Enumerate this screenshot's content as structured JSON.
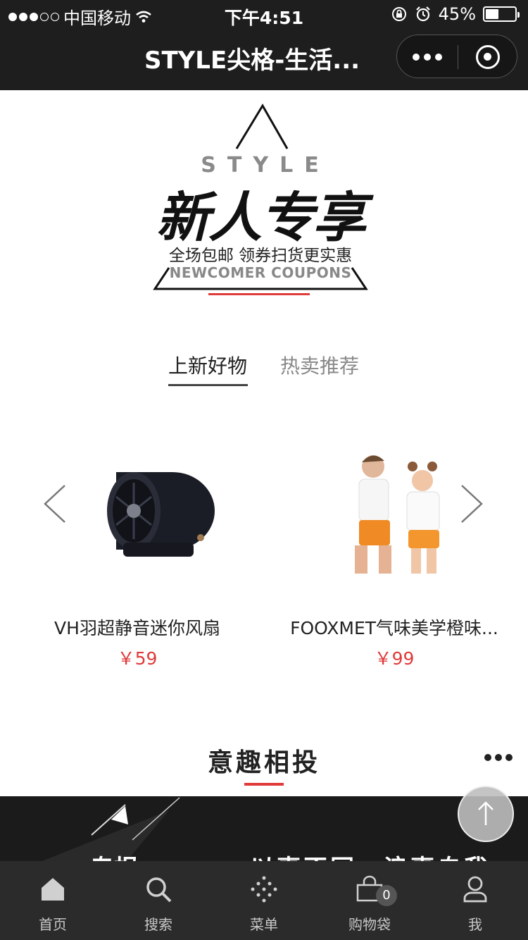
{
  "status_bar": {
    "carrier": "中国移动",
    "time": "下午4:51",
    "battery": "45%",
    "battery_level": 0.45
  },
  "nav": {
    "title": "STYLE尖格-生活..."
  },
  "banner": {
    "brand": "STYLE",
    "title": "新人专享",
    "subtitle": "全场包邮 领券扫货更实惠",
    "english": "NEWCOMER COUPONS"
  },
  "tabs": [
    {
      "label": "上新好物",
      "active": true
    },
    {
      "label": "热卖推荐",
      "active": false
    }
  ],
  "products": [
    {
      "name": "VH羽超静音迷你风扇",
      "price": "￥59"
    },
    {
      "name": "FOOXMET气味美学橙味...",
      "price": "￥99"
    }
  ],
  "section": {
    "title": "意趣相投"
  },
  "dark_banner": {
    "text_left": "专报",
    "text_right": "以事不同，浪事自我"
  },
  "tabbar": [
    {
      "label": "首页",
      "icon": "home-icon"
    },
    {
      "label": "搜索",
      "icon": "search-icon"
    },
    {
      "label": "菜单",
      "icon": "menu-dots-icon"
    },
    {
      "label": "购物袋",
      "icon": "shopping-bag-icon",
      "badge": "0"
    },
    {
      "label": "我",
      "icon": "user-icon"
    }
  ],
  "colors": {
    "accent": "#e03a3a",
    "bar": "#1e1e1e",
    "tabbar": "#2b2b2b"
  }
}
